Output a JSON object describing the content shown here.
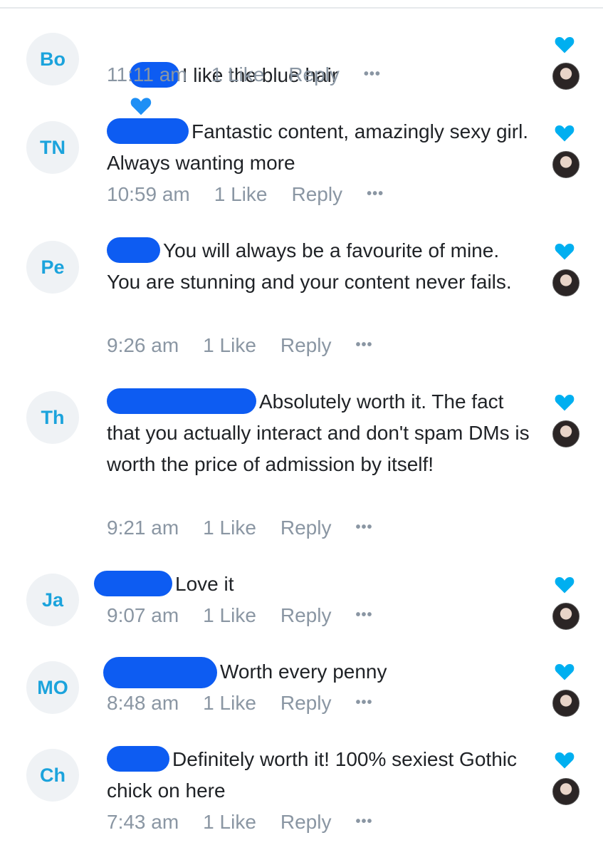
{
  "colors": {
    "accent": "#00aff0",
    "redaction": "#0d5cf2",
    "text": "#1f2226",
    "meta": "#8a96a3"
  },
  "comments": [
    {
      "initials": "Bo",
      "text": "I like the blue hair",
      "has_heart_emoji": true,
      "time": "11:11 am",
      "likes": "1 Like",
      "reply": "Reply",
      "more": "•••"
    },
    {
      "initials": "TN",
      "text": "Fantastic content, amazingly sexy girl. Always wanting more",
      "time": "10:59 am",
      "likes": "1 Like",
      "reply": "Reply",
      "more": "•••"
    },
    {
      "initials": "Pe",
      "text": "You will always be a favourite of mine. You are stunning and your content never fails.",
      "time": "9:26 am",
      "likes": "1 Like",
      "reply": "Reply",
      "more": "•••"
    },
    {
      "initials": "Th",
      "text": "Absolutely worth it. The fact that you actually interact and don't spam DMs is worth the price of admission by itself!",
      "time": "9:21 am",
      "likes": "1 Like",
      "reply": "Reply",
      "more": "•••"
    },
    {
      "initials": "Ja",
      "text": "Love it",
      "time": "9:07 am",
      "likes": "1 Like",
      "reply": "Reply",
      "more": "•••"
    },
    {
      "initials": "MO",
      "text": "Worth every penny",
      "time": "8:48 am",
      "likes": "1 Like",
      "reply": "Reply",
      "more": "•••"
    },
    {
      "initials": "Ch",
      "text": "Definitely worth it! 100% sexiest Gothic chick on here",
      "time": "7:43 am",
      "likes": "1 Like",
      "reply": "Reply",
      "more": "•••"
    }
  ]
}
